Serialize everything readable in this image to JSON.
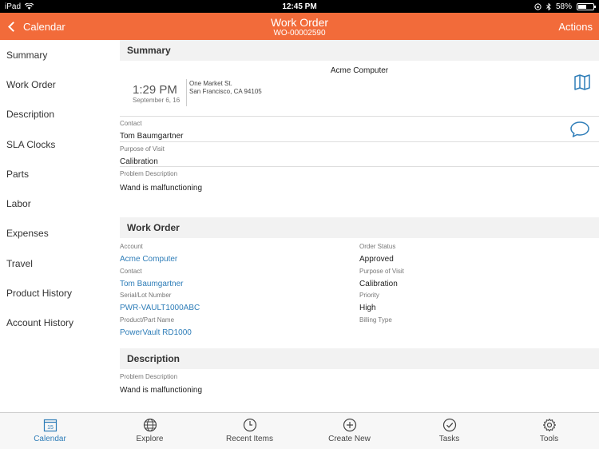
{
  "status": {
    "device": "iPad",
    "time": "12:45 PM",
    "battery": "58%"
  },
  "nav": {
    "back_label": "Calendar",
    "title": "Work Order",
    "subtitle": "WO-00002590",
    "actions_label": "Actions"
  },
  "sidebar": {
    "items": [
      {
        "label": "Summary"
      },
      {
        "label": "Work Order"
      },
      {
        "label": "Description"
      },
      {
        "label": "SLA Clocks"
      },
      {
        "label": "Parts"
      },
      {
        "label": "Labor"
      },
      {
        "label": "Expenses"
      },
      {
        "label": "Travel"
      },
      {
        "label": "Product History"
      },
      {
        "label": "Account History"
      }
    ]
  },
  "summary": {
    "heading": "Summary",
    "account": "Acme Computer",
    "time": "1:29 PM",
    "date": "September 6, 16",
    "address_line1": "One Market St.",
    "address_line2": "San Francisco, CA 94105",
    "contact_label": "Contact",
    "contact_value": "Tom Baumgartner",
    "purpose_label": "Purpose of Visit",
    "purpose_value": "Calibration",
    "problem_label": "Problem Description",
    "problem_value": "Wand is malfunctioning"
  },
  "work_order": {
    "heading": "Work Order",
    "account_label": "Account",
    "account_value": "Acme Computer",
    "contact_label": "Contact",
    "contact_value": "Tom Baumgartner",
    "serial_label": "Serial/Lot Number",
    "serial_value": "PWR-VAULT1000ABC",
    "product_label": "Product/Part Name",
    "product_value": "PowerVault RD1000",
    "status_label": "Order Status",
    "status_value": "Approved",
    "purpose_label": "Purpose of Visit",
    "purpose_value": "Calibration",
    "priority_label": "Priority",
    "priority_value": "High",
    "billing_label": "Billing Type",
    "billing_value": ""
  },
  "description": {
    "heading": "Description",
    "problem_label": "Problem Description",
    "problem_value": "Wand is malfunctioning"
  },
  "tabbar": {
    "calendar_day": "15",
    "tabs": [
      {
        "label": "Calendar",
        "icon": "calendar-icon"
      },
      {
        "label": "Explore",
        "icon": "globe-icon"
      },
      {
        "label": "Recent Items",
        "icon": "clock-icon"
      },
      {
        "label": "Create New",
        "icon": "plus-circle-icon"
      },
      {
        "label": "Tasks",
        "icon": "check-circle-icon"
      },
      {
        "label": "Tools",
        "icon": "gear-icon"
      }
    ]
  },
  "colors": {
    "accent": "#f26b3a",
    "link": "#2e7db8",
    "section_bg": "#f2f2f2"
  }
}
